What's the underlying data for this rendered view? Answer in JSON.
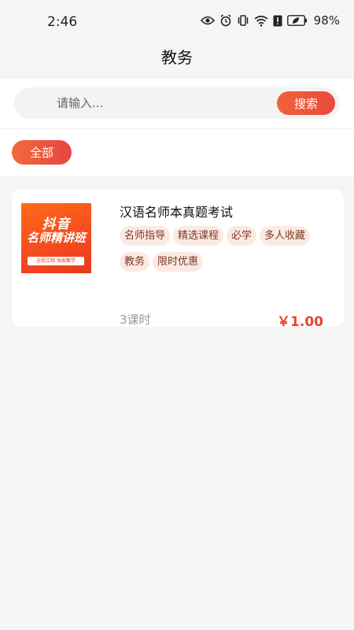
{
  "status_bar": {
    "time": "2:46",
    "battery": "98%",
    "icons": [
      "eye-icon",
      "alarm-icon",
      "vibrate-icon",
      "wifi-icon",
      "alert-icon",
      "battery-icon"
    ]
  },
  "header": {
    "title": "教务"
  },
  "search": {
    "placeholder": "请输入...",
    "value": "",
    "button_label": "搜索"
  },
  "filter": {
    "chips": [
      {
        "label": "全部",
        "selected": true
      }
    ]
  },
  "courses": [
    {
      "cover": {
        "line1": "抖音",
        "line2": "名师精讲班",
        "note": "全程立制  独家教学"
      },
      "title": "汉语名师本真题考试",
      "tags": [
        "名师指导",
        "精选课程",
        "必学",
        "多人收藏",
        "教务",
        "限时优惠"
      ],
      "lessons": "3课时",
      "price": "￥1.00"
    }
  ],
  "colors": {
    "accent": "#e84a3b",
    "accent_light": "#f0623a",
    "tag_bg": "#fbeae4",
    "tag_text": "#7a3a22",
    "page_bg": "#f5f5f5"
  }
}
